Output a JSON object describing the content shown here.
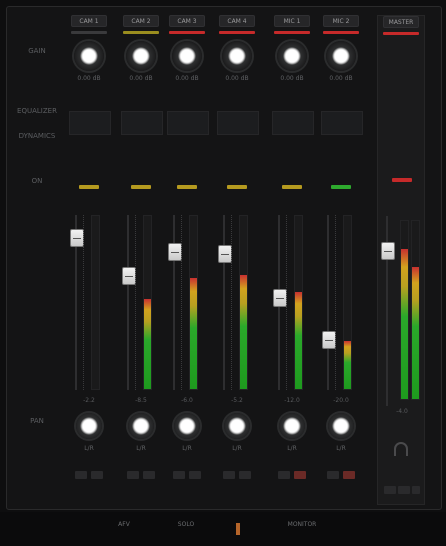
{
  "row_labels": {
    "gain": "GAIN",
    "eq": "EQUALIZER",
    "dynamics": "DYNAMICS",
    "on": "ON",
    "pan": "PAN"
  },
  "channels": [
    {
      "name": "CAM 1",
      "tab": "#3a3a3c",
      "gain": "0.00 dB",
      "level": "-2.2",
      "meter": 0.0,
      "pan": "L/R",
      "led": "#b59a1f"
    },
    {
      "name": "CAM 2",
      "tab": "#9a8d1f",
      "gain": "0.00 dB",
      "level": "-8.5",
      "meter": 0.52,
      "pan": "L/R",
      "led": "#b59a1f"
    },
    {
      "name": "CAM 3",
      "tab": "#c62a2a",
      "gain": "0.00 dB",
      "level": "-6.0",
      "meter": 0.64,
      "pan": "L/R",
      "led": "#b59a1f"
    },
    {
      "name": "CAM 4",
      "tab": "#c62a2a",
      "gain": "0.00 dB",
      "level": "-5.2",
      "meter": 0.66,
      "pan": "L/R",
      "led": "#b59a1f"
    },
    {
      "name": "MIC 1",
      "tab": "#c62a2a",
      "gain": "0.00 dB",
      "level": "-12.0",
      "meter": 0.56,
      "pan": "L/R",
      "led": "#b59a1f"
    },
    {
      "name": "MIC 2",
      "tab": "#c62a2a",
      "gain": "0.00 dB",
      "level": "-20.0",
      "meter": 0.28,
      "pan": "L/R",
      "led": "#2eaa2e"
    }
  ],
  "master": {
    "name": "MASTER",
    "tab": "#c62a2a",
    "level": "-4.0",
    "meter_l": 0.84,
    "meter_r": 0.74,
    "led": "#c62a2a"
  },
  "bottom": [
    {
      "label": "AFV"
    },
    {
      "label": "SOLO"
    },
    {
      "label": ""
    },
    {
      "label": "MONITOR"
    }
  ]
}
